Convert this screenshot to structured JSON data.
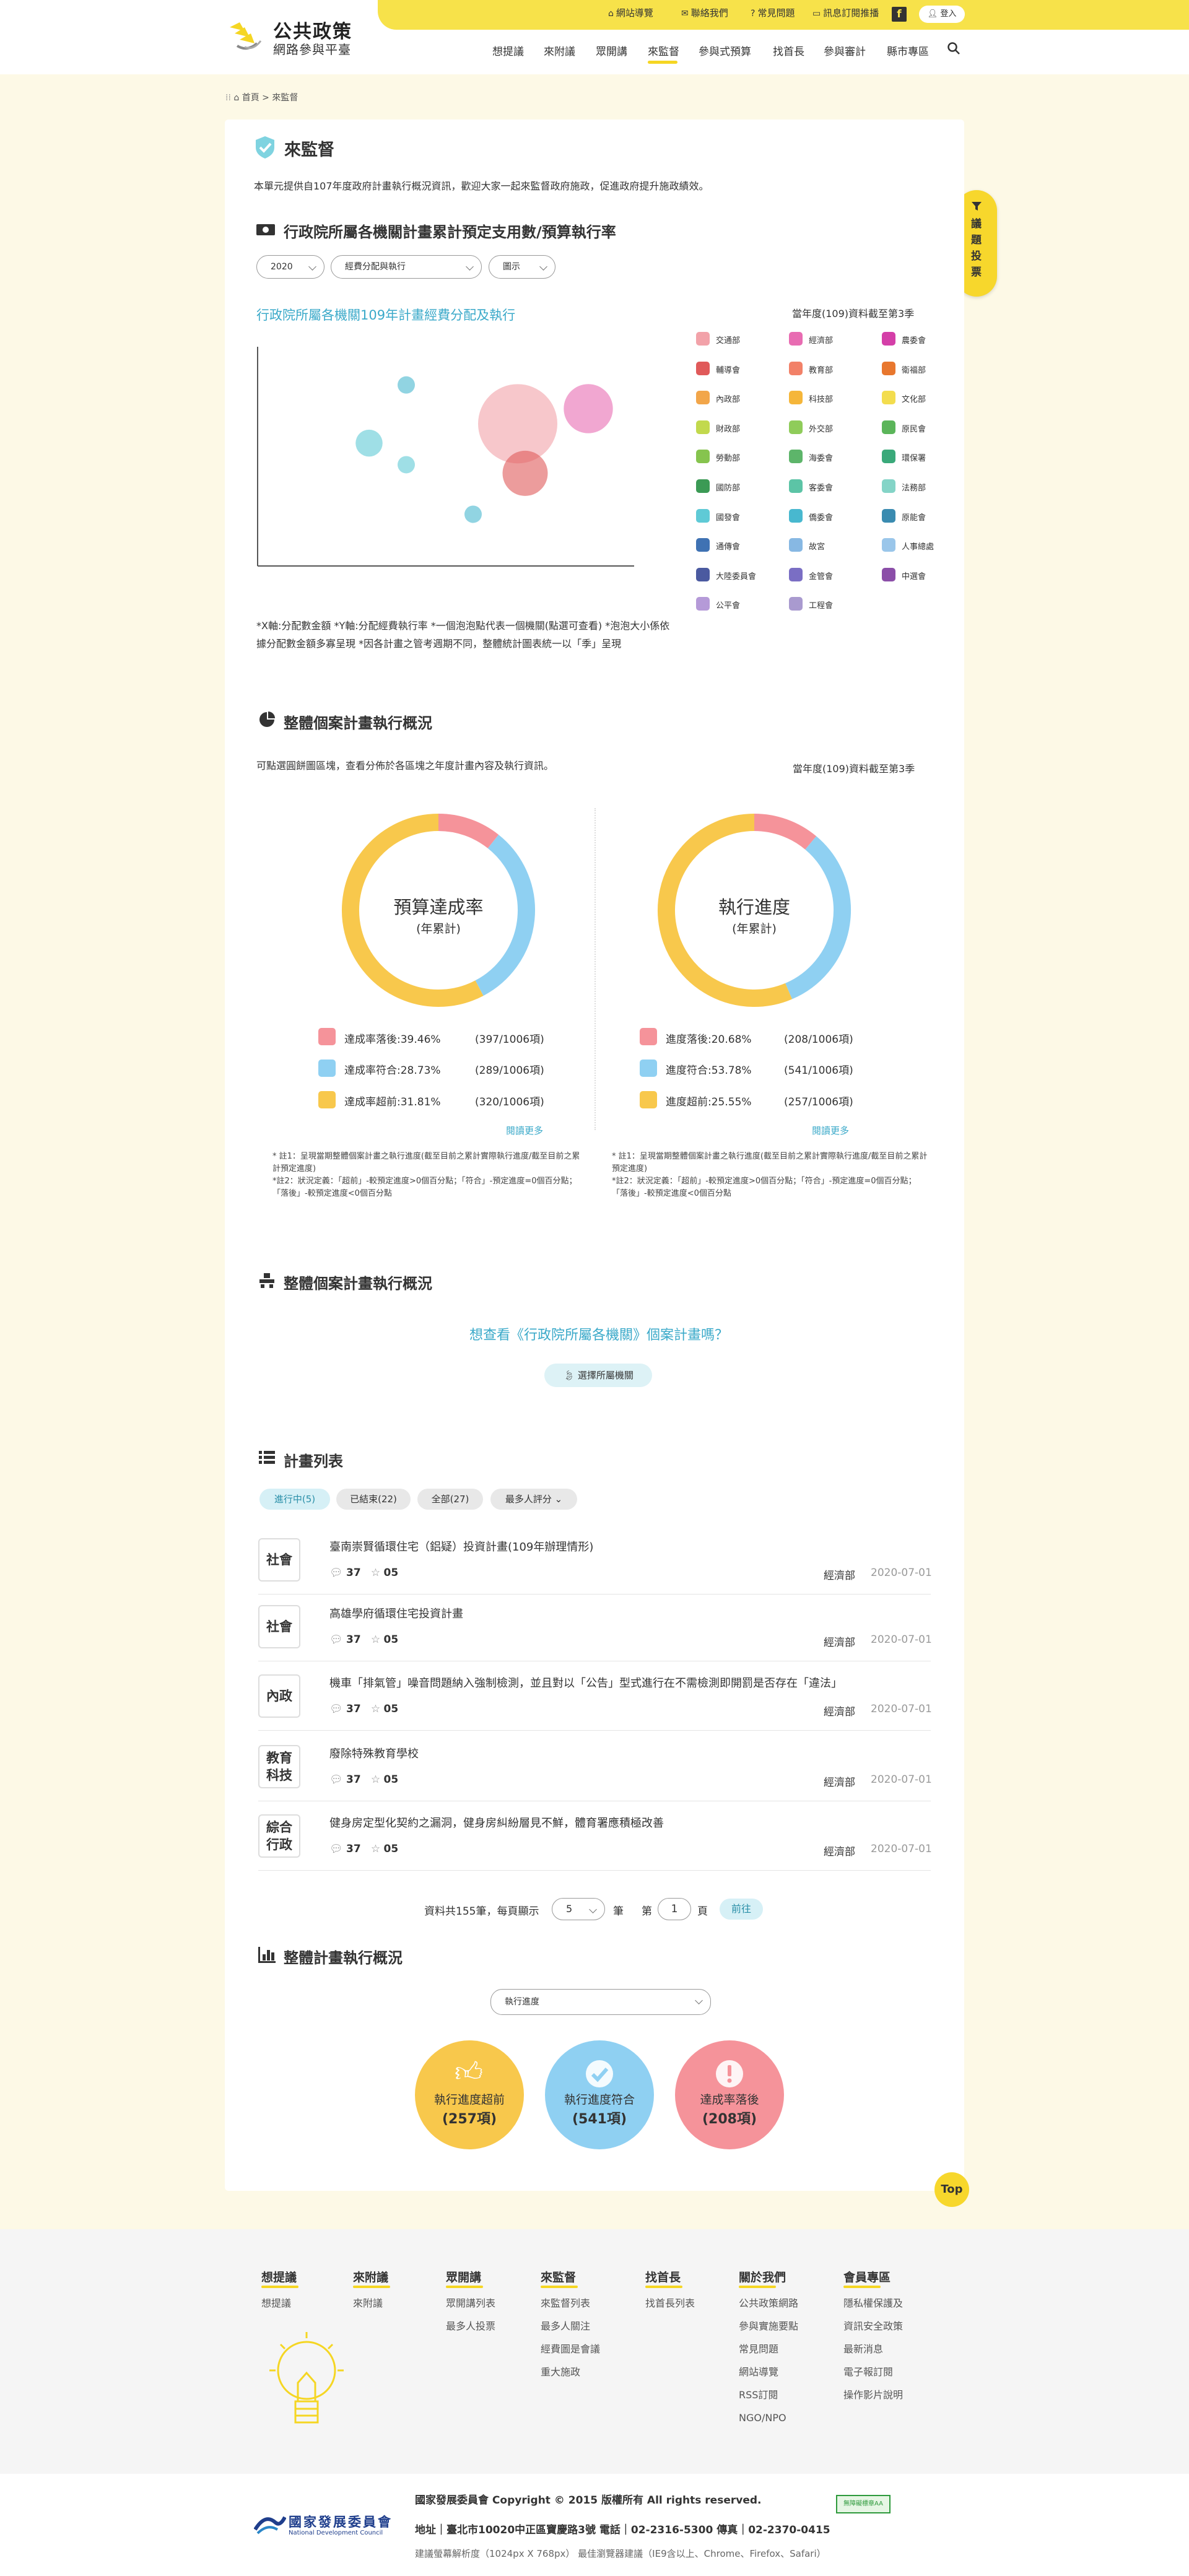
{
  "header": {
    "site_title": "公共政策",
    "site_subtitle": "網路參與平臺",
    "top_links": [
      "網站導覽",
      "聯絡我們",
      "常見問題",
      "訊息訂閱推播"
    ],
    "facebook": "f",
    "login": "登入",
    "nav": [
      "想提議",
      "來附議",
      "眾開講",
      "來監督",
      "參與式預算",
      "找首長",
      "參與審計",
      "縣市專區"
    ],
    "active_nav": "來監督"
  },
  "breadcrumb": {
    "home": "首頁",
    "current": "來監督"
  },
  "page": {
    "title": "來監督",
    "intro": "本單元提供自107年度政府計畫執行概況資訊，歡迎大家一起來監督政府施政，促進政府提升施政績效。"
  },
  "vote_tab": "議題投票",
  "section1": {
    "heading": "行政院所屬各機關計畫累計預定支用數/預算執行率",
    "filters": {
      "year": "2020",
      "type": "經費分配與執行",
      "view": "圖示"
    },
    "chart_title": "行政院所屬各機關109年計畫經費分配及執行",
    "data_note": "當年度(109)資料截至第3季",
    "footnote": "*X軸:分配數金額 *Y軸:分配經費執行率 *一個泡泡點代表一個機關(點選可查看) *泡泡大小係依據分配數金額多寡呈現 *因各計畫之管考週期不同，整體統計圖表統一以「季」呈現",
    "legend": [
      {
        "name": "交通部",
        "color": "#f2a2a9"
      },
      {
        "name": "經濟部",
        "color": "#e86cb2"
      },
      {
        "name": "農委會",
        "color": "#d43fa8"
      },
      {
        "name": "輔導會",
        "color": "#e05a5a"
      },
      {
        "name": "教育部",
        "color": "#f28168"
      },
      {
        "name": "衛福部",
        "color": "#e8772e"
      },
      {
        "name": "內政部",
        "color": "#f2a64a"
      },
      {
        "name": "科技部",
        "color": "#f5b63a"
      },
      {
        "name": "文化部",
        "color": "#f3dd4e"
      },
      {
        "name": "財政部",
        "color": "#c2d94d"
      },
      {
        "name": "外交部",
        "color": "#8fcc5a"
      },
      {
        "name": "原民會",
        "color": "#5bb55a"
      },
      {
        "name": "勞動部",
        "color": "#86c44e"
      },
      {
        "name": "海委會",
        "color": "#5db56a"
      },
      {
        "name": "環保署",
        "color": "#3aa97a"
      },
      {
        "name": "國防部",
        "color": "#3b9a55"
      },
      {
        "name": "客委會",
        "color": "#5cc4a6"
      },
      {
        "name": "法務部",
        "color": "#84d4c7"
      },
      {
        "name": "國發會",
        "color": "#5fcad6"
      },
      {
        "name": "僑委會",
        "color": "#48b8cf"
      },
      {
        "name": "原能會",
        "color": "#3a8bb0"
      },
      {
        "name": "通傳會",
        "color": "#3f72b3"
      },
      {
        "name": "故宮",
        "color": "#87b8e3"
      },
      {
        "name": "人事總處",
        "color": "#9ac6ea"
      },
      {
        "name": "大陸委員會",
        "color": "#4b5aa0"
      },
      {
        "name": "金管會",
        "color": "#7a6ec4"
      },
      {
        "name": "中選會",
        "color": "#8b4ea8"
      },
      {
        "name": "公平會",
        "color": "#b59ad8"
      },
      {
        "name": "工程會",
        "color": "#a99acf"
      }
    ]
  },
  "section2": {
    "heading": "整體個案計畫執行概況",
    "desc": "可點選圓餅圖區塊，查看分佈於各區塊之年度計畫內容及執行資訊。",
    "data_note": "當年度(109)資料截至第3季",
    "donut1": {
      "title": "預算達成率",
      "subtitle": "(年累計)",
      "items": [
        {
          "label": "達成率落後:39.46%",
          "count": "(397/1006項)",
          "color": "#f5939a"
        },
        {
          "label": "達成率符合:28.73%",
          "count": "(289/1006項)",
          "color": "#8fd0f2"
        },
        {
          "label": "達成率超前:31.81%",
          "count": "(320/1006項)",
          "color": "#f8c84c"
        }
      ],
      "more": "閱讀更多",
      "note": "* 註1：呈現當期整體個案計畫之執行進度(截至目前之累計實際執行進度/截至目前之累計預定進度)\n*註2：狀況定義：「超前」-較預定進度>0個百分點；「符合」-預定進度=0個百分點；「落後」-較預定進度<0個百分點"
    },
    "donut2": {
      "title": "執行進度",
      "subtitle": "(年累計)",
      "items": [
        {
          "label": "進度落後:20.68%",
          "count": "(208/1006項)",
          "color": "#f5939a"
        },
        {
          "label": "進度符合:53.78%",
          "count": "(541/1006項)",
          "color": "#8fd0f2"
        },
        {
          "label": "進度超前:25.55%",
          "count": "(257/1006項)",
          "color": "#f8c84c"
        }
      ],
      "more": "閱讀更多",
      "note": "* 註1：呈現當期整體個案計畫之執行進度(截至目前之累計實際執行進度/截至目前之累計預定進度)\n*註2：狀況定義：「超前」-較預定進度>0個百分點；「符合」-預定進度=0個百分點；「落後」-較預定進度<0個百分點"
    }
  },
  "section3": {
    "heading": "整體個案計畫執行概況",
    "question": "想查看《行政院所屬各機關》個案計畫嗎？",
    "button": "選擇所屬機關"
  },
  "section4": {
    "heading": "計畫列表",
    "tabs": [
      "進行中(5)",
      "已結束(22)",
      "全部(27)"
    ],
    "sort": "最多人評分",
    "rows": [
      {
        "cat": "社會",
        "title": "臺南崇賢循環住宅（鋁疑）投資計畫(109年辦理情形)",
        "comments": "37",
        "stars": "05",
        "dept": "經濟部",
        "date": "2020-07-01"
      },
      {
        "cat": "社會",
        "title": "高雄學府循環住宅投資計畫",
        "comments": "37",
        "stars": "05",
        "dept": "經濟部",
        "date": "2020-07-01"
      },
      {
        "cat": "內政",
        "title": "機車「排氣管」噪音問題納入強制檢測，並且對以「公告」型式進行在不需檢測即開罰是否存在「違法」",
        "comments": "37",
        "stars": "05",
        "dept": "經濟部",
        "date": "2020-07-01"
      },
      {
        "cat": "教育科技",
        "title": "廢除特殊教育學校",
        "comments": "37",
        "stars": "05",
        "dept": "經濟部",
        "date": "2020-07-01"
      },
      {
        "cat": "綜合行政",
        "title": "健身房定型化契約之漏洞，健身房糾紛層見不鮮，體育署應積極改善",
        "comments": "37",
        "stars": "05",
        "dept": "經濟部",
        "date": "2020-07-01"
      }
    ],
    "pager": {
      "total_text": "資料共155筆，每頁顯示",
      "per_page": "5",
      "unit": "筆",
      "page_prefix": "第",
      "page": "1",
      "page_suffix": "頁",
      "go": "前往"
    }
  },
  "section5": {
    "heading": "整體計畫執行概況",
    "select": "執行進度",
    "circles": [
      {
        "label": "執行進度超前",
        "count": "(257項)",
        "color": "#f8c84c"
      },
      {
        "label": "執行進度符合",
        "count": "(541項)",
        "color": "#8fd0f2"
      },
      {
        "label": "達成率落後",
        "count": "(208項)",
        "color": "#f5939a"
      }
    ]
  },
  "top_button": "Top",
  "footer": {
    "columns": [
      {
        "title": "想提議",
        "items": [
          "想提議"
        ]
      },
      {
        "title": "來附議",
        "items": [
          "來附議"
        ]
      },
      {
        "title": "眾開講",
        "items": [
          "眾開講列表",
          "最多人投票"
        ]
      },
      {
        "title": "來監督",
        "items": [
          "來監督列表",
          "最多人關注",
          "經費圖是會議",
          "重大施政"
        ]
      },
      {
        "title": "找首長",
        "items": [
          "找首長列表"
        ]
      },
      {
        "title": "關於我們",
        "items": [
          "公共政策網路",
          "參與實施要點",
          "常見問題",
          "網站導覽",
          "RSS訂閱",
          "NGO/NPO"
        ]
      },
      {
        "title": "會員專區",
        "items": [
          "隱私權保護及",
          "資訊安全政策",
          "最新消息",
          "電子報訂閱",
          "操作影片說明"
        ]
      }
    ],
    "org": "國家發展委員會",
    "org_en": "National Development Council",
    "copyright": "國家發展委員會 Copyright © 2015 版權所有 All rights reserved.",
    "address": "地址｜臺北市10020中正區寶慶路3號 電話｜02-2316-5300 傳真｜02-2370-0415",
    "browser": "建議螢幕解析度（1024px X 768px） 最佳瀏覽器建議（IE9含以上、Chrome、Firefox、Safari）",
    "badge": "無障礙標章AA"
  },
  "chart_data": [
    {
      "type": "scatter",
      "title": "行政院所屬各機關109年計畫經費分配及執行",
      "xlabel": "",
      "ylabel": "",
      "note": "bubble size = allocated amount",
      "series": [
        {
          "name": "交通部",
          "x": 0.7,
          "y": 0.66,
          "size": 1.0
        },
        {
          "name": "經濟部",
          "x": 0.89,
          "y": 0.73,
          "size": 0.62
        },
        {
          "name": "輔導會",
          "x": 0.72,
          "y": 0.43,
          "size": 0.57
        },
        {
          "name": "國發會",
          "x": 0.3,
          "y": 0.57,
          "size": 0.34
        },
        {
          "name": "僑委會",
          "x": 0.4,
          "y": 0.84,
          "size": 0.19
        },
        {
          "name": "國發會",
          "x": 0.4,
          "y": 0.47,
          "size": 0.19
        },
        {
          "name": "僑委會",
          "x": 0.58,
          "y": 0.24,
          "size": 0.19
        }
      ]
    },
    {
      "type": "pie",
      "title": "預算達成率",
      "categories": [
        "達成率落後",
        "達成率符合",
        "達成率超前"
      ],
      "values": [
        39.46,
        28.73,
        31.81
      ],
      "drawn": [
        0.107,
        0.316,
        0.577
      ],
      "colors": [
        "#f5939a",
        "#8fd0f2",
        "#f8c84c"
      ]
    },
    {
      "type": "pie",
      "title": "執行進度",
      "categories": [
        "進度落後",
        "進度符合",
        "進度超前"
      ],
      "values": [
        20.68,
        53.78,
        25.55
      ],
      "drawn": [
        0.111,
        0.325,
        0.564
      ],
      "colors": [
        "#f5939a",
        "#8fd0f2",
        "#f8c84c"
      ]
    }
  ]
}
